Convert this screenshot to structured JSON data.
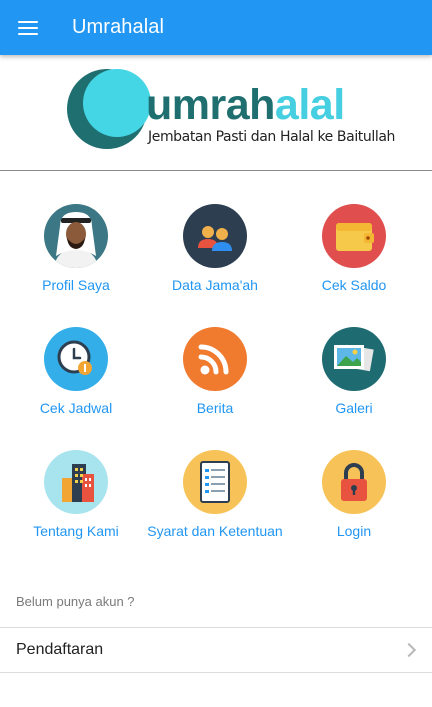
{
  "app_bar": {
    "title": "Umrahalal",
    "menu_icon": "menu-icon",
    "color": "#2196f3"
  },
  "logo": {
    "word_dark": "umrah",
    "word_light": "alal",
    "tagline": "Jembatan Pasti dan Halal  ke Baitullah",
    "colors": {
      "dark": "#1f6f70",
      "light": "#45cfe0"
    }
  },
  "menu": [
    {
      "label": "Profil Saya",
      "icon": "profile-icon"
    },
    {
      "label": "Data Jama'ah",
      "icon": "people-icon"
    },
    {
      "label": "Cek Saldo",
      "icon": "wallet-icon"
    },
    {
      "label": "Cek Jadwal",
      "icon": "clock-icon"
    },
    {
      "label": "Berita",
      "icon": "rss-icon"
    },
    {
      "label": "Galeri",
      "icon": "gallery-icon"
    },
    {
      "label": "Tentang Kami",
      "icon": "building-icon"
    },
    {
      "label": "Syarat dan Ketentuan",
      "icon": "checklist-icon"
    },
    {
      "label": "Login",
      "icon": "lock-icon"
    }
  ],
  "register": {
    "hint": "Belum punya akun ?",
    "label": "Pendaftaran"
  }
}
